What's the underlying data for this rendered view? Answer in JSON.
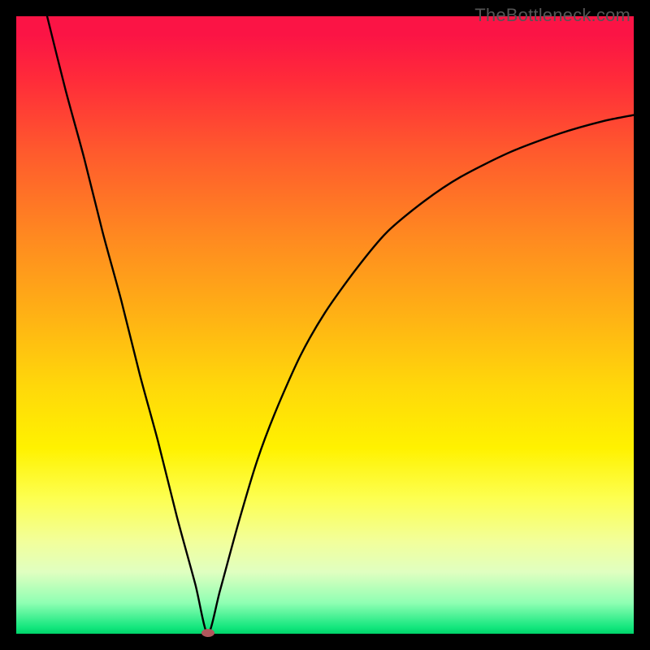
{
  "watermark": "TheBottleneck.com",
  "chart_data": {
    "type": "line",
    "title": "",
    "xlabel": "",
    "ylabel": "",
    "xlim": [
      0,
      100
    ],
    "ylim": [
      0,
      100
    ],
    "grid": false,
    "legend": false,
    "minimum": {
      "x": 31,
      "y": 0,
      "marker": {
        "color": "#b1565c"
      }
    },
    "background_gradient": {
      "top": "#fb1445",
      "middle": "#fff200",
      "bottom": "#00d36a"
    },
    "series": [
      {
        "name": "bottleneck-curve",
        "color": "#000000",
        "x": [
          5,
          8,
          11,
          14,
          17,
          20,
          23,
          26,
          29,
          31,
          33,
          36,
          39,
          42,
          46,
          50,
          55,
          60,
          66,
          72,
          80,
          88,
          95,
          100
        ],
        "y": [
          100,
          88,
          77,
          65,
          54,
          42,
          31,
          19,
          8,
          0,
          7,
          18,
          28,
          36,
          45,
          52,
          59,
          65,
          70,
          74,
          78,
          81,
          83,
          84
        ]
      }
    ]
  }
}
